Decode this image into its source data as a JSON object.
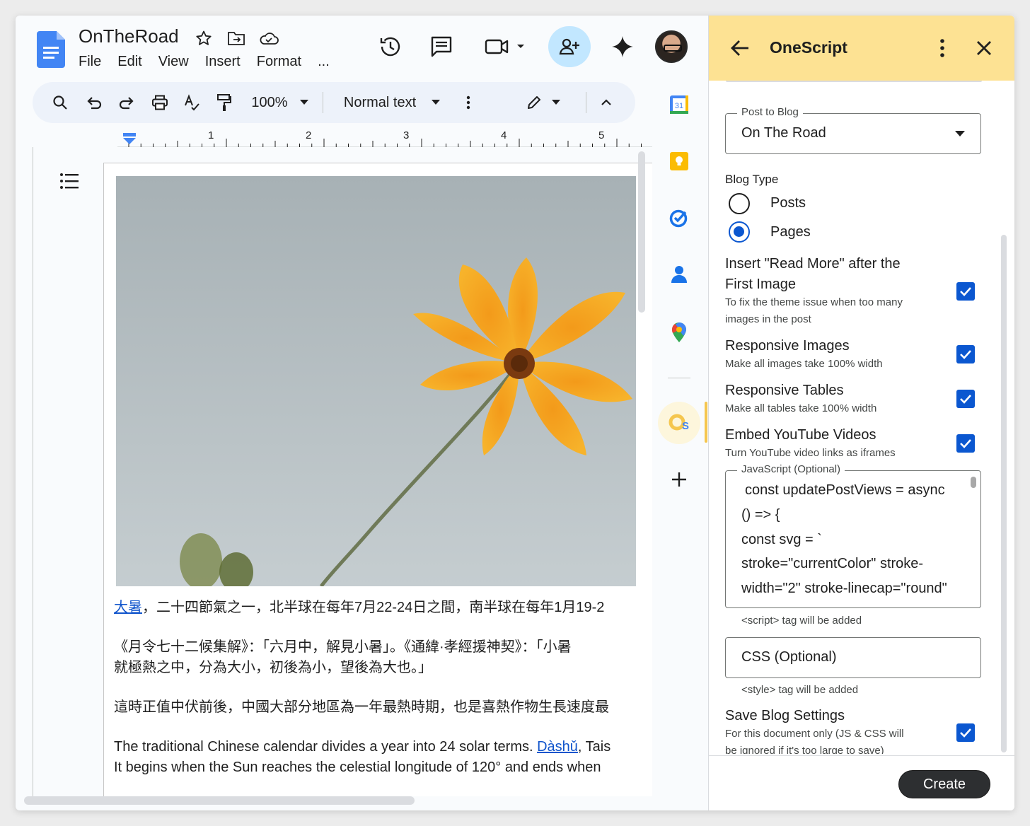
{
  "doc": {
    "title": "OnTheRoad",
    "menu": [
      "File",
      "Edit",
      "View",
      "Insert",
      "Format",
      "..."
    ]
  },
  "toolbar": {
    "zoom": "100%",
    "style": "Normal text"
  },
  "ruler": {
    "numbers": [
      "1",
      "2",
      "3",
      "4",
      "5"
    ]
  },
  "content": {
    "p1_link": "大暑",
    "p1_rest": "，二十四節氣之一，北半球在每年7月22-24日之間，南半球在每年1月19-2",
    "p2_line1": "《月令七十二候集解》：「六月中，解見小暑」。《通緯·孝經援神契》：「小暑",
    "p2_line2": "就極熱之中，分為大小，初後為小，望後為大也。」",
    "p3": "這時正值中伏前後，中國大部分地區為一年最熱時期，也是喜熱作物生長速度最",
    "p4_line1_a": "The traditional Chinese calendar divides a year into 24 solar terms. ",
    "p4_link": "Dàshǔ",
    "p4_line1_b": ", Tais",
    "p4_line2": "It begins when the Sun reaches the celestial longitude of 120° and ends when"
  },
  "panel": {
    "title": "OneScript",
    "post_to_blog_label": "Post to Blog",
    "post_to_blog_value": "On The Road",
    "blog_type_label": "Blog Type",
    "blog_type_options": [
      "Posts",
      "Pages"
    ],
    "blog_type_selected": "Pages",
    "options": [
      {
        "title_line1": "Insert \"Read More\" after the",
        "title_line2": "First Image",
        "desc_line1": "To fix the theme issue when too many",
        "desc_line2": "images in the post",
        "checked": true
      },
      {
        "title": "Responsive Images",
        "desc": "Make all images take 100% width",
        "checked": true
      },
      {
        "title": "Responsive Tables",
        "desc": "Make all tables take 100% width",
        "checked": true
      },
      {
        "title": "Embed YouTube Videos",
        "desc": "Turn YouTube video links as iframes",
        "checked": true
      }
    ],
    "js_label": "JavaScript (Optional)",
    "js_lines": [
      "const updatePostViews = async",
      "() => {",
      "const svg = `",
      "stroke=\"currentColor\" stroke-",
      "width=\"2\" stroke-linecap=\"round\""
    ],
    "js_hint": "<script> tag will be added",
    "css_placeholder": "CSS (Optional)",
    "css_hint": "<style> tag will be added",
    "save": {
      "title": "Save Blog Settings",
      "desc_line1": "For this document only (JS & CSS will",
      "desc_line2": "be ignored if it's too large to save)",
      "checked": true
    },
    "create_label": "Create"
  },
  "colors": {
    "panel_header": "#fde293",
    "accent": "#0b57d0",
    "share_bg": "#c2e7ff",
    "link": "#1155cc"
  }
}
